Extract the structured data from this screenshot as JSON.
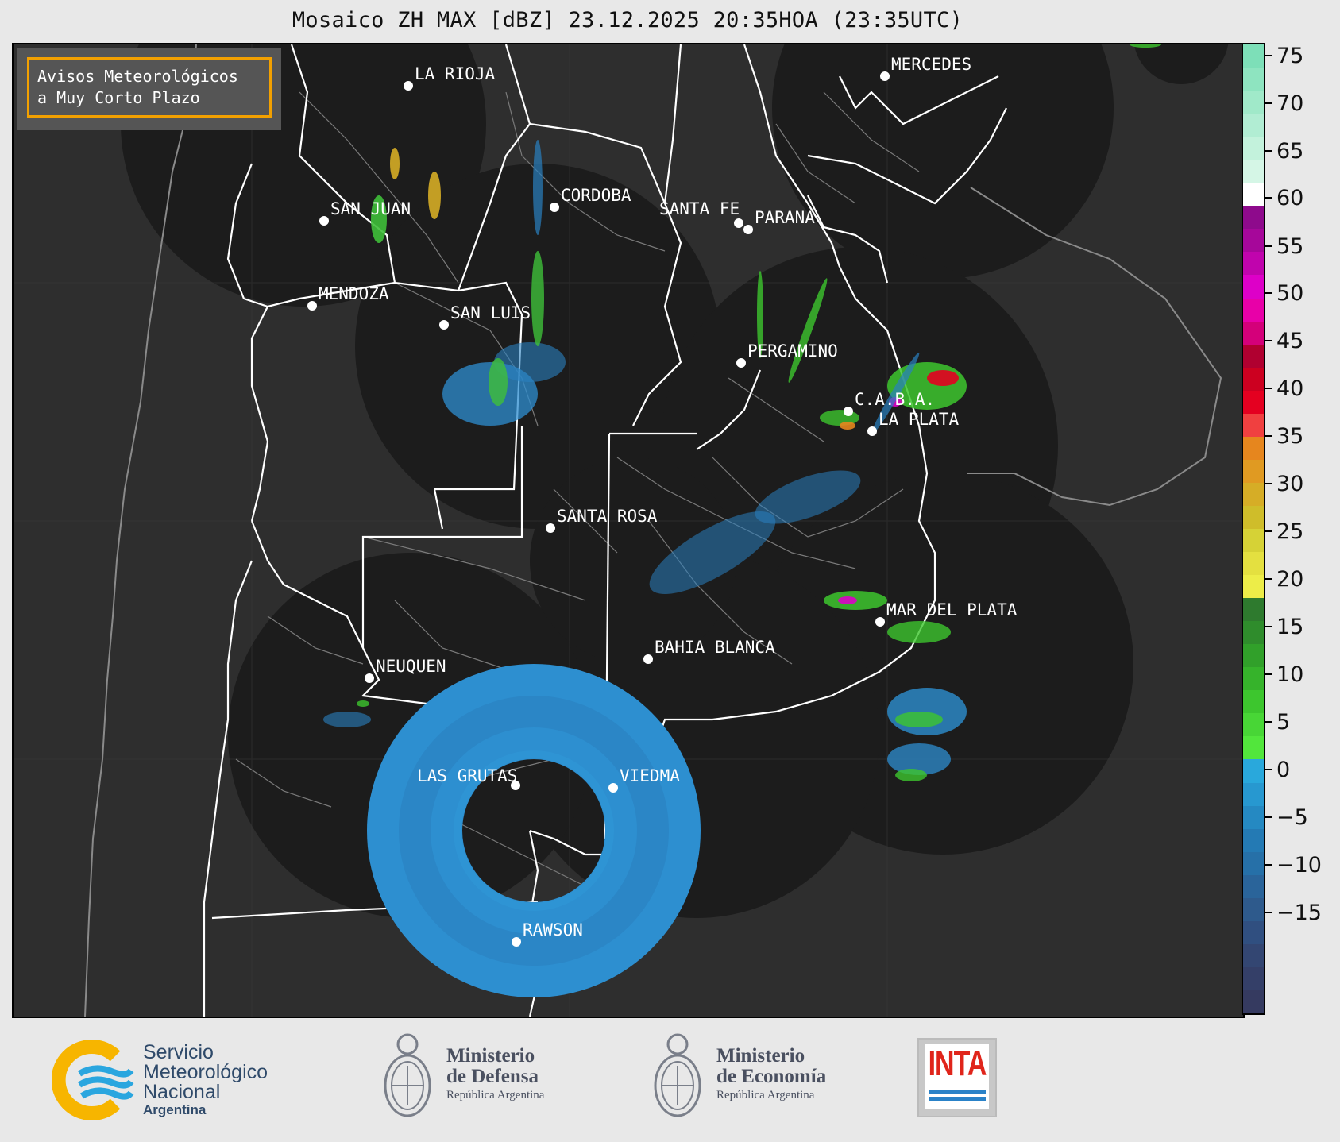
{
  "title": "Mosaico ZH MAX [dBZ] 23.12.2025 20:35HOA (23:35UTC)",
  "notice": {
    "line1": "Avisos Meteorológicos",
    "line2": "a Muy Corto Plazo"
  },
  "colorbar": {
    "ticks": [
      "75",
      "70",
      "65",
      "60",
      "55",
      "50",
      "45",
      "40",
      "35",
      "30",
      "25",
      "20",
      "15",
      "10",
      "5",
      "0",
      "−5",
      "−10",
      "−15"
    ],
    "segments": [
      "#7ddfb8",
      "#8ee4c0",
      "#a0e9c9",
      "#b1edd3",
      "#c3f2dc",
      "#d5f6e6",
      "#ffffff",
      "#8e0a8c",
      "#a6079a",
      "#c004ad",
      "#dd00c8",
      "#e800a8",
      "#d4007a",
      "#b00030",
      "#cc0020",
      "#e40020",
      "#f04040",
      "#e6861e",
      "#e09a22",
      "#d6ad26",
      "#cfbd2a",
      "#d6d236",
      "#e4e040",
      "#eded48",
      "#2e7a2e",
      "#2f8c2c",
      "#31a02a",
      "#36b32b",
      "#3dc62e",
      "#48d636",
      "#52e63c",
      "#29a8dc",
      "#2798d0",
      "#2589c2",
      "#247ab4",
      "#2670a8",
      "#2a649a",
      "#2e5a8c",
      "#304f80",
      "#334672",
      "#343f68",
      "#353a60"
    ],
    "accent_border": "#f2a000"
  },
  "cities": [
    {
      "name": "LA RIOJA"
    },
    {
      "name": "MERCEDES"
    },
    {
      "name": "CORDOBA"
    },
    {
      "name": "SAN JUAN"
    },
    {
      "name": "SANTA FE"
    },
    {
      "name": "PARANA"
    },
    {
      "name": "MENDOZA"
    },
    {
      "name": "SAN LUIS"
    },
    {
      "name": "PERGAMINO"
    },
    {
      "name": "C.A.B.A."
    },
    {
      "name": "LA PLATA"
    },
    {
      "name": "SANTA ROSA"
    },
    {
      "name": "MAR DEL PLATA"
    },
    {
      "name": "BAHIA BLANCA"
    },
    {
      "name": "NEUQUEN"
    },
    {
      "name": "LAS GRUTAS"
    },
    {
      "name": "VIEDMA"
    },
    {
      "name": "RAWSON"
    }
  ],
  "footer": {
    "smn": {
      "line1": "Servicio",
      "line2": "Meteorológico",
      "line3": "Nacional",
      "line4": "Argentina"
    },
    "defensa": {
      "line1": "Ministerio",
      "line2": "de Defensa",
      "line3": "República Argentina"
    },
    "economia": {
      "line1": "Ministerio",
      "line2": "de Economía",
      "line3": "República Argentina"
    },
    "inta": {
      "label": "INTA"
    }
  }
}
